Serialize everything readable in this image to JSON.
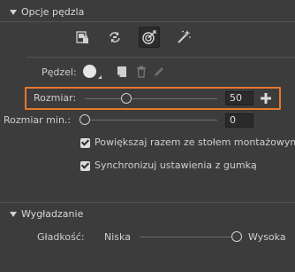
{
  "brush_options": {
    "title": "Opcje pędzla",
    "tools": [
      {
        "icon": "image-lock-icon"
      },
      {
        "icon": "rotate-brush-icon"
      },
      {
        "icon": "target-brush-icon",
        "active": true
      },
      {
        "icon": "magic-wand-icon"
      }
    ],
    "brush_label": "Pędzel:",
    "size_label": "Rozmiar:",
    "size_value": "50",
    "size_fraction": 0.3,
    "min_size_label": "Rozmiar min.:",
    "min_size_value": "0",
    "min_size_fraction": 0,
    "scale_with_stage_label": "Powiększaj razem ze stołem montażowym",
    "scale_with_stage_checked": true,
    "sync_eraser_label": "Synchronizuj ustawienia z gumką",
    "sync_eraser_checked": true
  },
  "smoothing": {
    "title": "Wygładzanie",
    "smoothness_label": "Gładkość:",
    "low_label": "Niska",
    "high_label": "Wysoka",
    "smoothness_fraction": 1
  },
  "colors": {
    "accent": "#e8782a",
    "background": "#3c3c3c"
  }
}
